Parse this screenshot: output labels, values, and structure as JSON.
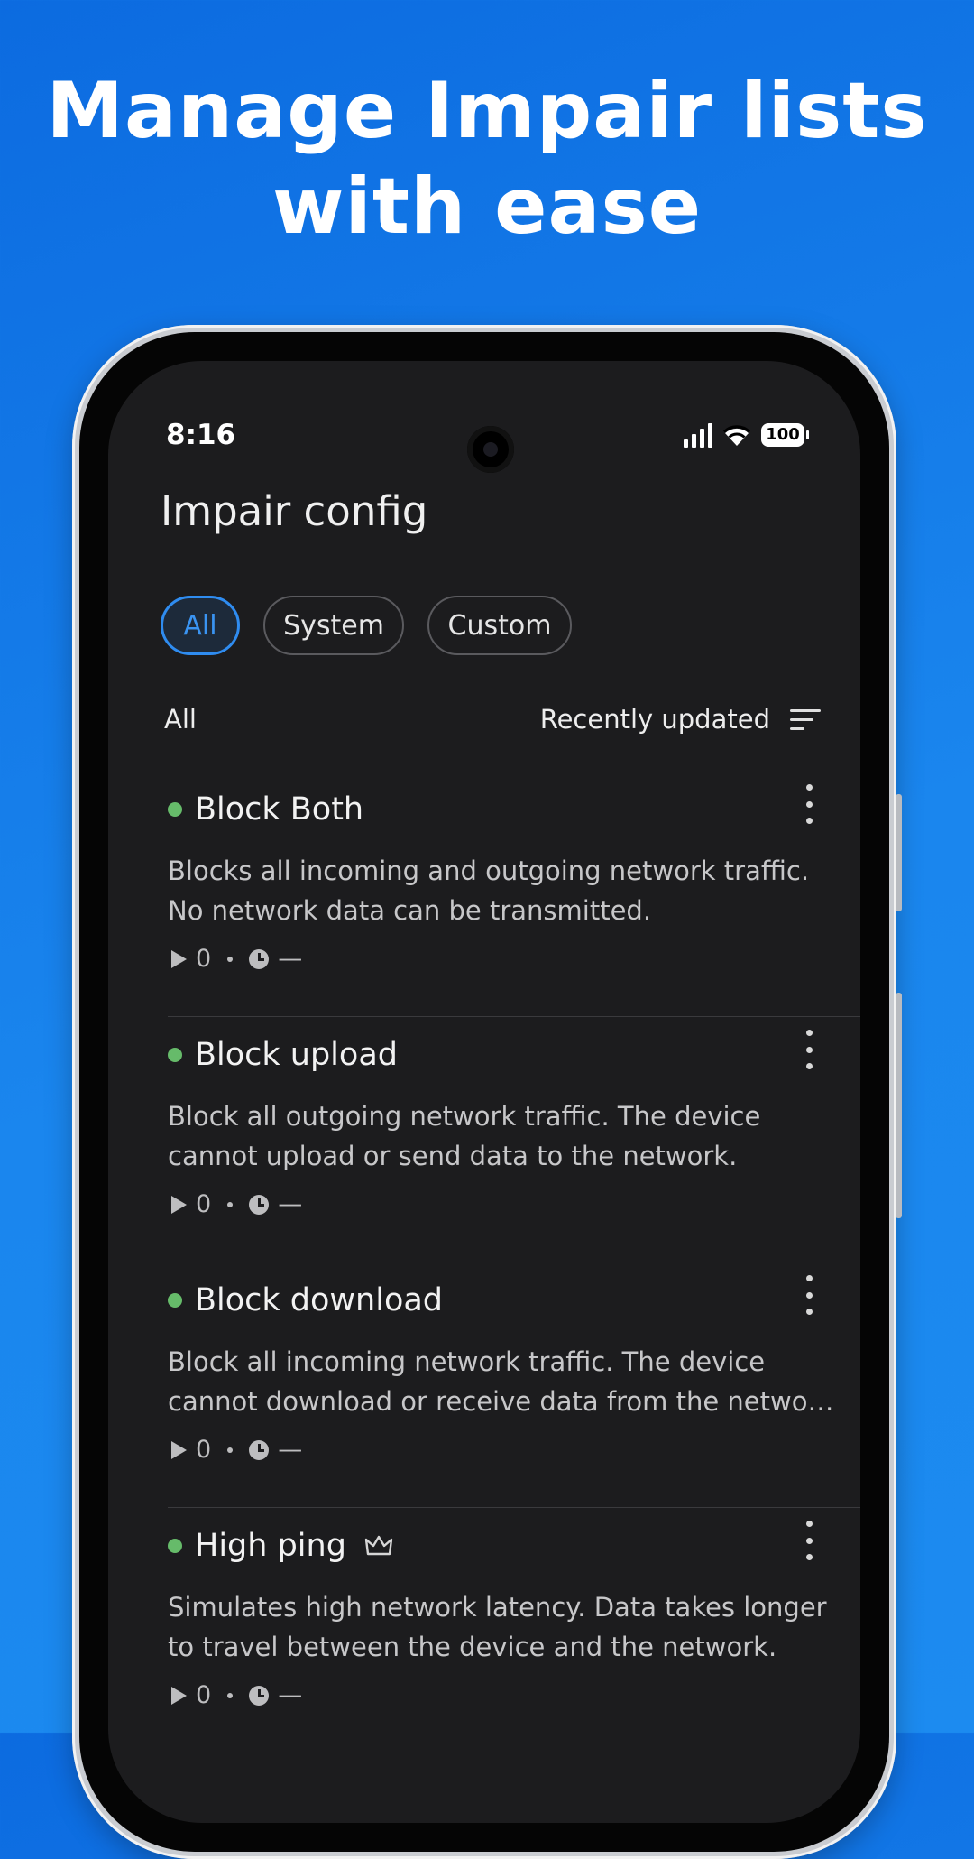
{
  "headline": {
    "line1": "Manage Impair lists",
    "line2": "with ease"
  },
  "status_bar": {
    "time": "8:16",
    "battery": "100"
  },
  "app": {
    "title": "Impair config"
  },
  "filters": [
    {
      "label": "All",
      "active": true
    },
    {
      "label": "System",
      "active": false
    },
    {
      "label": "Custom",
      "active": false
    }
  ],
  "list_header": {
    "label": "All",
    "sort_label": "Recently updated"
  },
  "items": [
    {
      "title": "Block Both",
      "description": "Blocks all incoming and outgoing network traffic. No network data can be transmitted.",
      "runs": "0",
      "last_used": "—",
      "premium": false,
      "status_color": "#66bb6a"
    },
    {
      "title": "Block upload",
      "description": "Block all outgoing network traffic. The device cannot upload or send data to the network.",
      "runs": "0",
      "last_used": "—",
      "premium": false,
      "status_color": "#66bb6a"
    },
    {
      "title": "Block download",
      "description": "Block all incoming network traffic. The device cannot download or receive data from the netwo…",
      "runs": "0",
      "last_used": "—",
      "premium": false,
      "status_color": "#66bb6a"
    },
    {
      "title": "High ping",
      "description": "Simulates high network latency. Data takes longer to travel between the device and the network.",
      "runs": "0",
      "last_used": "—",
      "premium": true,
      "status_color": "#66bb6a"
    }
  ],
  "colors": {
    "background_top": "#0c6be0",
    "background_bottom": "#1c8bf0",
    "screen": "#1c1c1e",
    "accent": "#2f8cf0",
    "status_dot": "#66bb6a"
  },
  "icons": {
    "sort": "sort-lines-icon",
    "more": "more-vertical-icon",
    "play": "play-icon",
    "clock": "clock-icon",
    "premium": "crown-icon",
    "signal": "signal-icon",
    "wifi": "wifi-icon",
    "battery": "battery-icon"
  }
}
